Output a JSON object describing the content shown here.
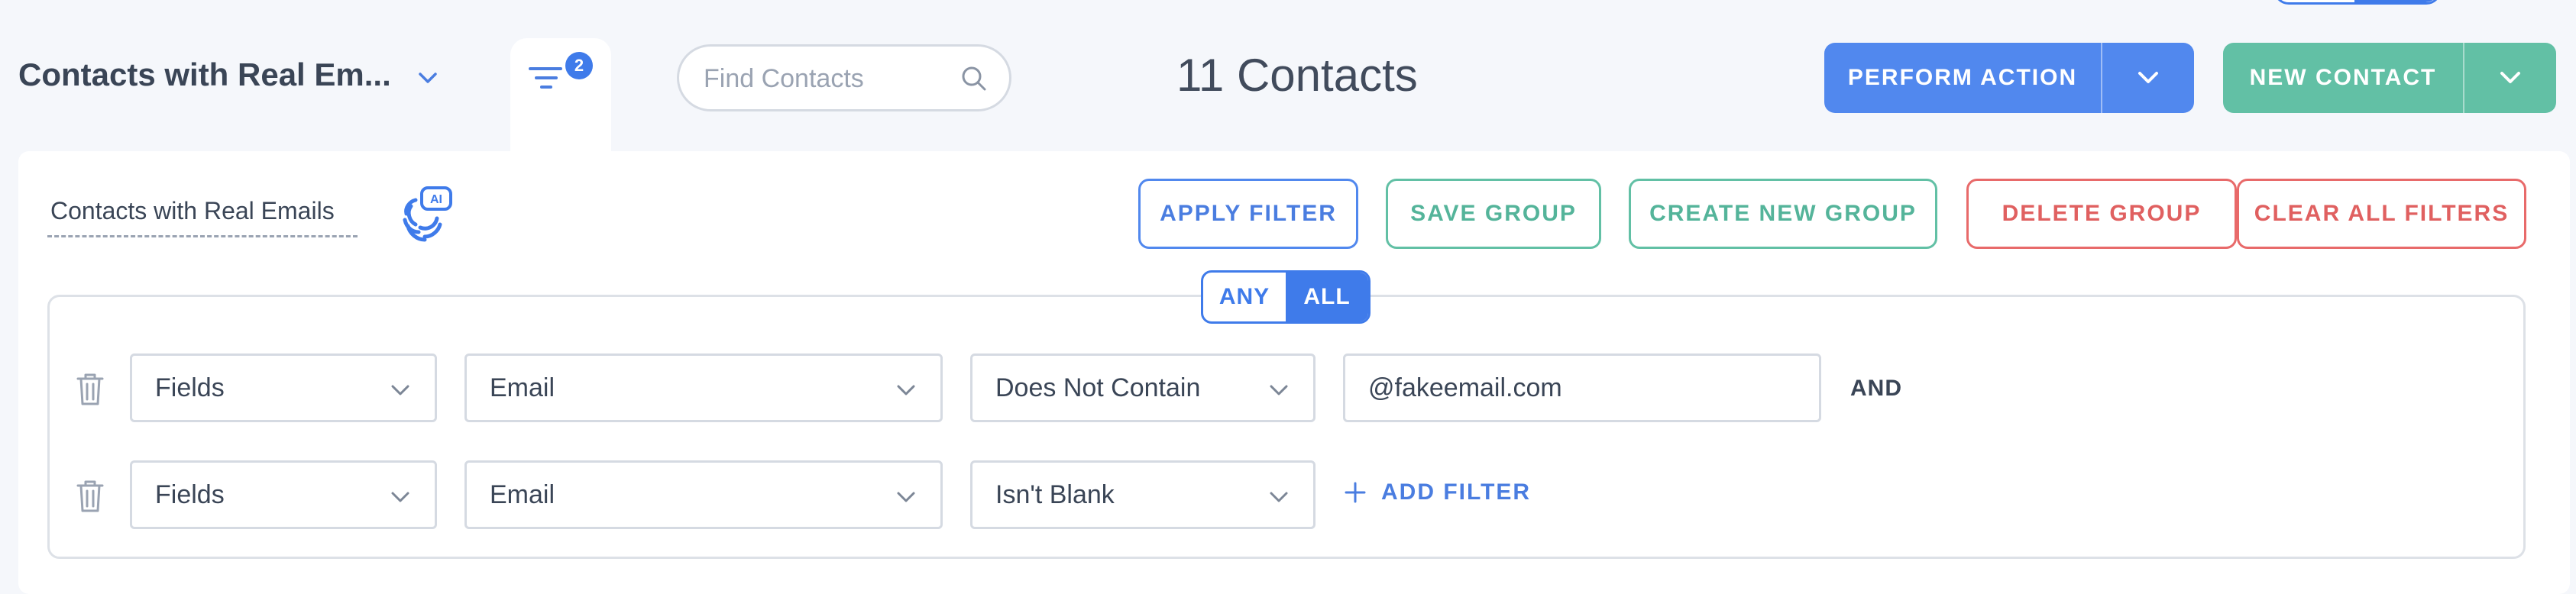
{
  "header": {
    "group_title": "Contacts with Real Em...",
    "filter_badge_count": "2",
    "search_placeholder": "Find Contacts",
    "contacts_count": "11 Contacts",
    "perform_action_label": "PERFORM ACTION",
    "new_contact_label": "NEW CONTACT"
  },
  "group": {
    "name": "Contacts with Real Emails",
    "ai_badge": "AI"
  },
  "actions": {
    "apply_filter": "APPLY FILTER",
    "save_group": "SAVE GROUP",
    "create_new_group": "CREATE NEW GROUP",
    "delete_group": "DELETE GROUP",
    "clear_all_filters": "CLEAR ALL FILTERS"
  },
  "match_mode": {
    "any_label": "ANY",
    "all_label": "ALL",
    "selected": "ALL"
  },
  "filters": [
    {
      "category": "Fields",
      "field": "Email",
      "operator": "Does Not Contain",
      "value": "@fakeemail.com",
      "connector": "AND"
    },
    {
      "category": "Fields",
      "field": "Email",
      "operator": "Isn't Blank"
    }
  ],
  "add_filter_label": "ADD FILTER",
  "colors": {
    "primary": "#3f7bea",
    "button_blue": "#5188ee",
    "button_green": "#62c0a5",
    "danger": "#e86a6a",
    "background": "#f5f7fb"
  }
}
